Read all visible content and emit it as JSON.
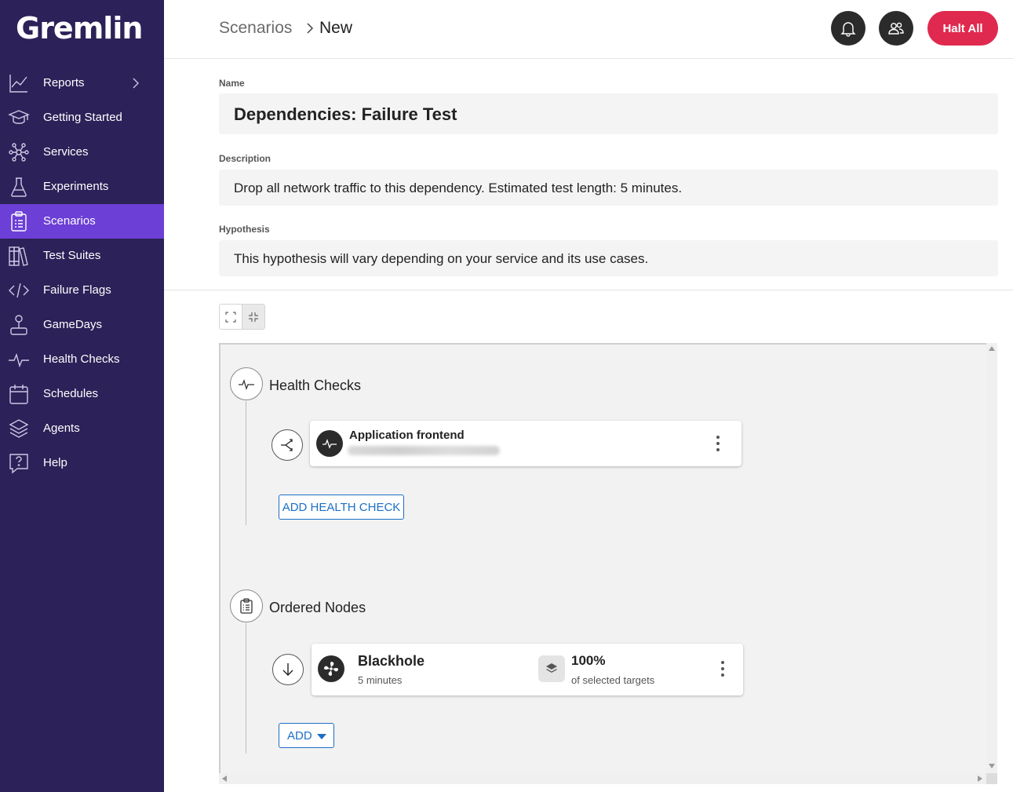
{
  "app": {
    "logo_text": "Gremlin"
  },
  "sidebar": {
    "items": [
      {
        "label": "Reports",
        "icon": "chart-line-icon"
      },
      {
        "label": "Getting Started",
        "icon": "graduation-cap-icon"
      },
      {
        "label": "Services",
        "icon": "network-nodes-icon"
      },
      {
        "label": "Experiments",
        "icon": "flask-icon"
      },
      {
        "label": "Scenarios",
        "icon": "clipboard-list-icon",
        "active": true
      },
      {
        "label": "Test Suites",
        "icon": "books-icon"
      },
      {
        "label": "Failure Flags",
        "icon": "code-brackets-icon"
      },
      {
        "label": "GameDays",
        "icon": "joystick-icon"
      },
      {
        "label": "Health Checks",
        "icon": "heartbeat-icon"
      },
      {
        "label": "Schedules",
        "icon": "calendar-icon"
      },
      {
        "label": "Agents",
        "icon": "layers-icon"
      },
      {
        "label": "Help",
        "icon": "question-bubble-icon"
      }
    ]
  },
  "header": {
    "breadcrumb_root": "Scenarios",
    "breadcrumb_current": "New",
    "halt_label": "Halt All"
  },
  "form": {
    "name_label": "Name",
    "name_value": "Dependencies: Failure Test",
    "description_label": "Description",
    "description_value": "Drop all network traffic to this dependency. Estimated test length: 5 minutes.",
    "hypothesis_label": "Hypothesis",
    "hypothesis_value": "This hypothesis will vary depending on your service and its use cases."
  },
  "canvas": {
    "health_checks": {
      "title": "Health Checks",
      "card_title": "Application frontend",
      "add_label": "ADD HEALTH CHECK"
    },
    "ordered_nodes": {
      "title": "Ordered Nodes",
      "node_title": "Blackhole",
      "node_duration": "5 minutes",
      "target_percent": "100%",
      "target_caption": "of selected targets",
      "add_label": "ADD"
    }
  },
  "colors": {
    "sidebar_bg": "#2c2158",
    "sidebar_active": "#6c3fd6",
    "halt_button": "#e0294f",
    "link_blue": "#1d6fc4"
  }
}
